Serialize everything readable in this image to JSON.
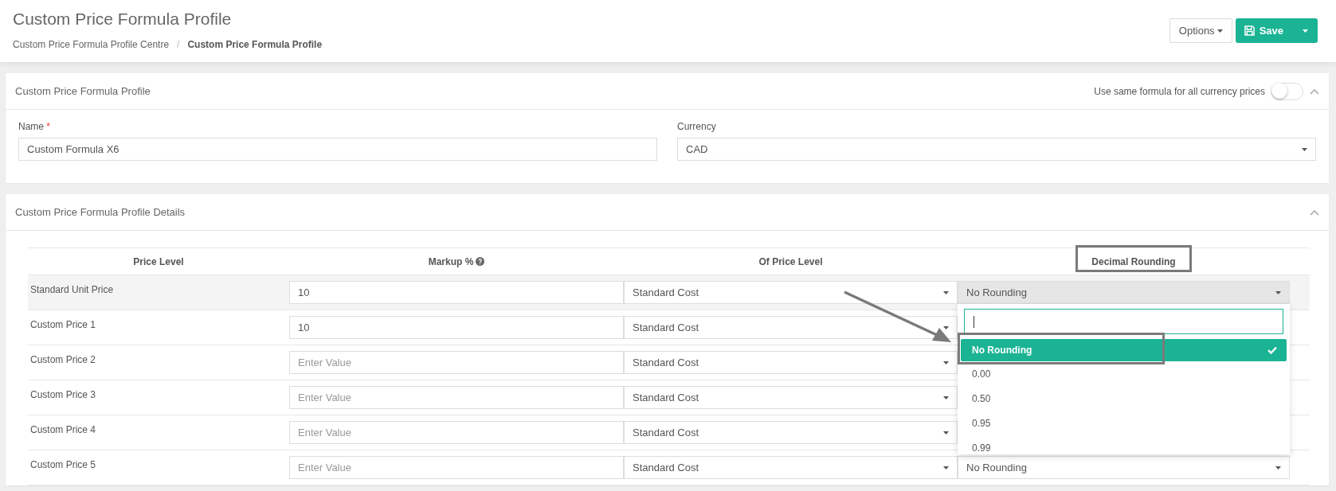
{
  "page": {
    "title": "Custom Price Formula Profile",
    "breadcrumb_separator": "/",
    "breadcrumb": [
      {
        "label": "Custom Price Formula Profile Centre",
        "current": false
      },
      {
        "label": "Custom Price Formula Profile",
        "current": true
      }
    ]
  },
  "actions": {
    "options": "Options",
    "save": "Save"
  },
  "profile_panel": {
    "title": "Custom Price Formula Profile",
    "toggle_label": "Use same formula for all currency prices",
    "toggle_on": false,
    "expanded": true,
    "name": {
      "label": "Name",
      "required_mark": "*",
      "value": "Custom Formula X6"
    },
    "currency": {
      "label": "Currency",
      "value": "CAD"
    }
  },
  "details_panel": {
    "title": "Custom Price Formula Profile Details",
    "expanded": true,
    "columns": [
      "Price Level",
      "Markup %",
      "Of Price Level",
      "Decimal Rounding"
    ],
    "rows": [
      {
        "price_level": "Standard Unit Price",
        "markup": {
          "value": "10"
        },
        "of_price_level": "Standard Cost",
        "rounding": "No Rounding",
        "highlighted": true,
        "rounding_open": true
      },
      {
        "price_level": "Custom Price 1",
        "markup": {
          "value": "10"
        },
        "of_price_level": "Standard Cost",
        "highlighted": false,
        "rounding_open": false
      },
      {
        "price_level": "Custom Price 2",
        "markup": {
          "placeholder": "Enter Value"
        },
        "of_price_level": "Standard Cost",
        "highlighted": false,
        "rounding_open": false
      },
      {
        "price_level": "Custom Price 3",
        "markup": {
          "placeholder": "Enter Value"
        },
        "of_price_level": "Standard Cost",
        "highlighted": false,
        "rounding_open": false
      },
      {
        "price_level": "Custom Price 4",
        "markup": {
          "placeholder": "Enter Value"
        },
        "of_price_level": "Standard Cost",
        "highlighted": false,
        "rounding_open": false
      },
      {
        "price_level": "Custom Price 5",
        "markup": {
          "placeholder": "Enter Value"
        },
        "of_price_level": "Standard Cost",
        "rounding": "No Rounding",
        "highlighted": false,
        "rounding_open": false
      }
    ],
    "rounding_dropdown": {
      "options": [
        {
          "label": "No Rounding",
          "selected": true
        },
        {
          "label": "0.00",
          "selected": false
        },
        {
          "label": "0.50",
          "selected": false
        },
        {
          "label": "0.95",
          "selected": false
        },
        {
          "label": "0.99",
          "selected": false
        }
      ]
    }
  }
}
